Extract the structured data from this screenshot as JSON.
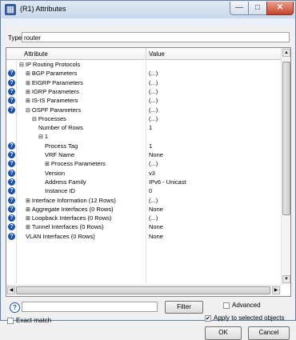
{
  "window": {
    "title": "(R1) Attributes",
    "min_glyph": "—",
    "max_glyph": "□",
    "close_glyph": "✕",
    "app_icon": "network-icon"
  },
  "type_field": {
    "label": "Type:",
    "value": "router"
  },
  "table": {
    "headers": {
      "attribute": "Attribute",
      "value": "Value"
    },
    "help_glyph": "?",
    "rows": [
      {
        "help": false,
        "toggle": "⊟",
        "level": 0,
        "attribute": "IP Routing Protocols",
        "value": ""
      },
      {
        "help": true,
        "toggle": "⊞",
        "level": 1,
        "attribute": "BGP Parameters",
        "value": "(...)"
      },
      {
        "help": true,
        "toggle": "⊞",
        "level": 1,
        "attribute": "EIGRP Parameters",
        "value": "(...)"
      },
      {
        "help": true,
        "toggle": "⊞",
        "level": 1,
        "attribute": "IGRP Parameters",
        "value": "(...)"
      },
      {
        "help": true,
        "toggle": "⊞",
        "level": 1,
        "attribute": "IS-IS Parameters",
        "value": "(...)"
      },
      {
        "help": true,
        "toggle": "⊟",
        "level": 1,
        "attribute": "OSPF Parameters",
        "value": "(...)"
      },
      {
        "help": false,
        "toggle": "⊟",
        "level": 2,
        "attribute": "Processes",
        "value": "(...)"
      },
      {
        "help": false,
        "toggle": "",
        "level": 3,
        "attribute": "Number of Rows",
        "value": "1"
      },
      {
        "help": false,
        "toggle": "⊟",
        "level": 3,
        "attribute": "1",
        "value": ""
      },
      {
        "help": true,
        "toggle": "",
        "level": 4,
        "attribute": "Process Tag",
        "value": "1"
      },
      {
        "help": true,
        "toggle": "",
        "level": 4,
        "attribute": "VRF Name",
        "value": "None"
      },
      {
        "help": true,
        "toggle": "⊞",
        "level": 4,
        "attribute": "Process Parameters",
        "value": "(...)"
      },
      {
        "help": true,
        "toggle": "",
        "level": 4,
        "attribute": "Version",
        "value": "v3"
      },
      {
        "help": true,
        "toggle": "",
        "level": 4,
        "attribute": "Address Family",
        "value": "IPv6 - Unicast"
      },
      {
        "help": true,
        "toggle": "",
        "level": 4,
        "attribute": "Instance ID",
        "value": "0"
      },
      {
        "help": true,
        "toggle": "⊞",
        "level": 1,
        "attribute": "Interface Information (12 Rows)",
        "value": "(...)"
      },
      {
        "help": true,
        "toggle": "⊞",
        "level": 1,
        "attribute": "Aggregate Interfaces (0 Rows)",
        "value": "None"
      },
      {
        "help": true,
        "toggle": "⊞",
        "level": 1,
        "attribute": "Loopback Interfaces (0 Rows)",
        "value": "(...)"
      },
      {
        "help": true,
        "toggle": "⊞",
        "level": 1,
        "attribute": "Tunnel Interfaces (0 Rows)",
        "value": "None"
      },
      {
        "help": true,
        "toggle": "",
        "level": 1,
        "attribute": "VLAN Interfaces (0 Rows)",
        "value": "None"
      }
    ]
  },
  "scroll": {
    "up_glyph": "▲",
    "down_glyph": "▼",
    "left_glyph": "◀",
    "right_glyph": "▶"
  },
  "bottom": {
    "help_glyph": "?",
    "filter_value": "",
    "filter_button": "Filter",
    "advanced": {
      "label": "Advanced",
      "checked": false
    },
    "exact_match": {
      "label": "Exact match",
      "checked": false
    },
    "apply_selected": {
      "label": "Apply to selected objects",
      "checked": true
    },
    "ok_button": "OK",
    "cancel_button": "Cancel",
    "check_glyph": "✔"
  }
}
